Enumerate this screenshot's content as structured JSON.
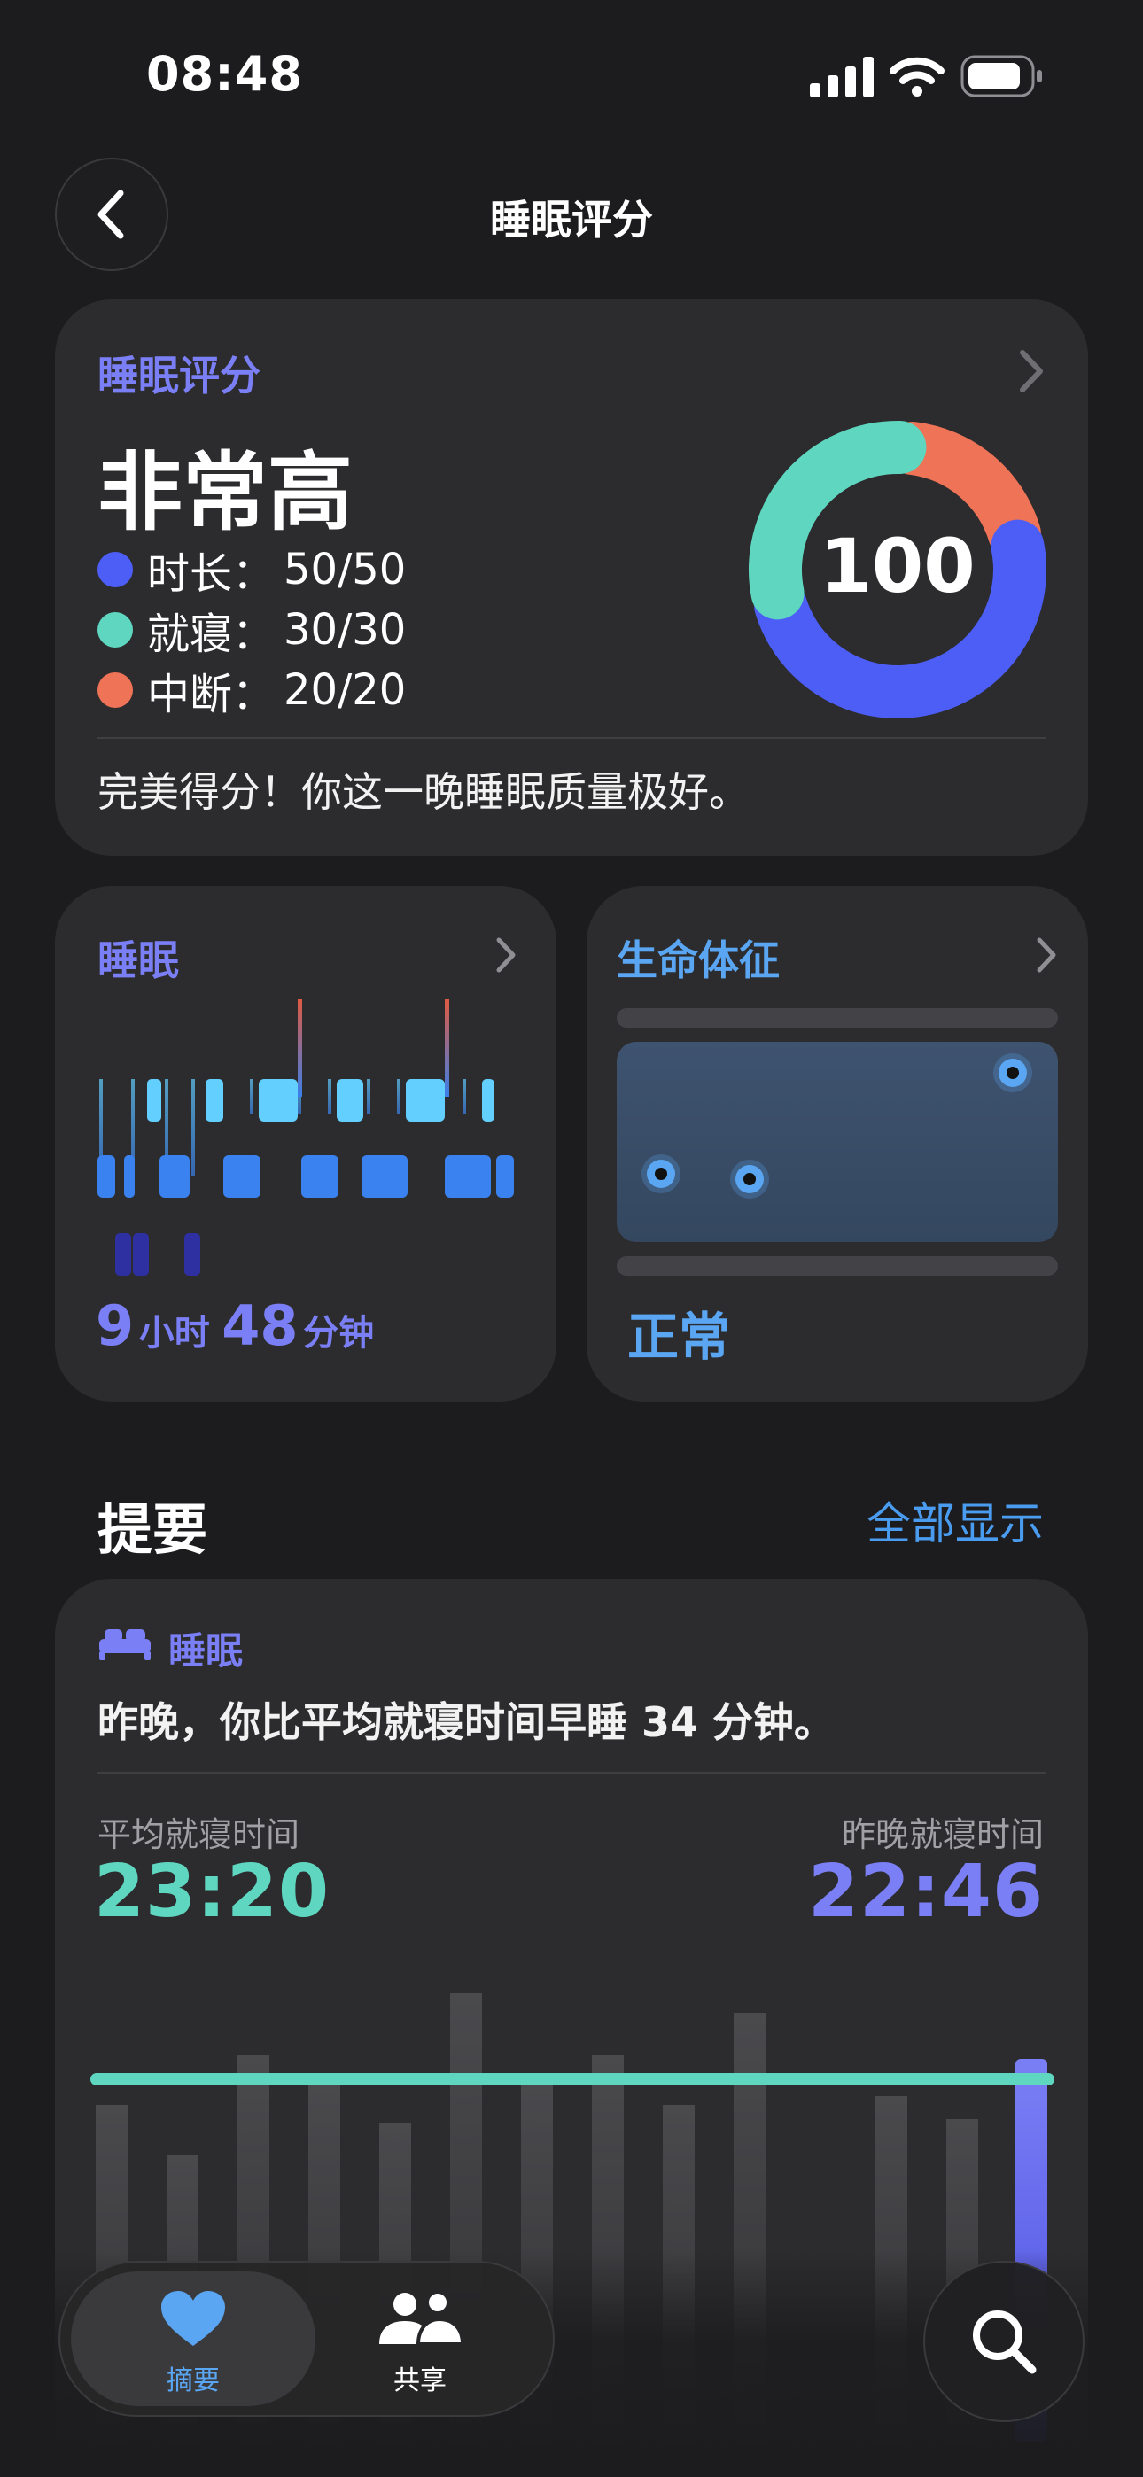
{
  "status_bar": {
    "time": "08:48"
  },
  "nav": {
    "title": "睡眠评分"
  },
  "score_card": {
    "title": "睡眠评分",
    "level": "非常高",
    "score": "100",
    "components": [
      {
        "label": "时长：",
        "value": "50/50",
        "color": "#4d5ef6",
        "score": 50
      },
      {
        "label": "就寝：",
        "value": "30/30",
        "color": "#5fd6bf",
        "score": 30
      },
      {
        "label": "中断：",
        "value": "20/20",
        "color": "#ef7356",
        "score": 20
      }
    ],
    "summary": "完美得分！你这一晚睡眠质量极好。"
  },
  "sleep_card": {
    "title": "睡眠",
    "hours": "9",
    "hours_unit": "小时",
    "minutes": "48",
    "minutes_unit": "分钟"
  },
  "vitals_card": {
    "title": "生命体征",
    "status": "正常"
  },
  "highlights": {
    "section_title": "提要",
    "show_all": "全部显示",
    "category": "睡眠",
    "headline": "昨晚，你比平均就寝时间早睡 34 分钟。",
    "avg_label": "平均就寝时间",
    "avg_value": "23:20",
    "last_label": "昨晚就寝时间",
    "last_value": "22:46"
  },
  "tab_bar": {
    "tabs": [
      {
        "label": "摘要",
        "icon": "heart-icon",
        "active": true
      },
      {
        "label": "共享",
        "icon": "people-icon",
        "active": false
      }
    ]
  },
  "colors": {
    "accent": "#7b7ff5",
    "teal": "#5fd6bf",
    "blue_link": "#4a9cf0"
  }
}
